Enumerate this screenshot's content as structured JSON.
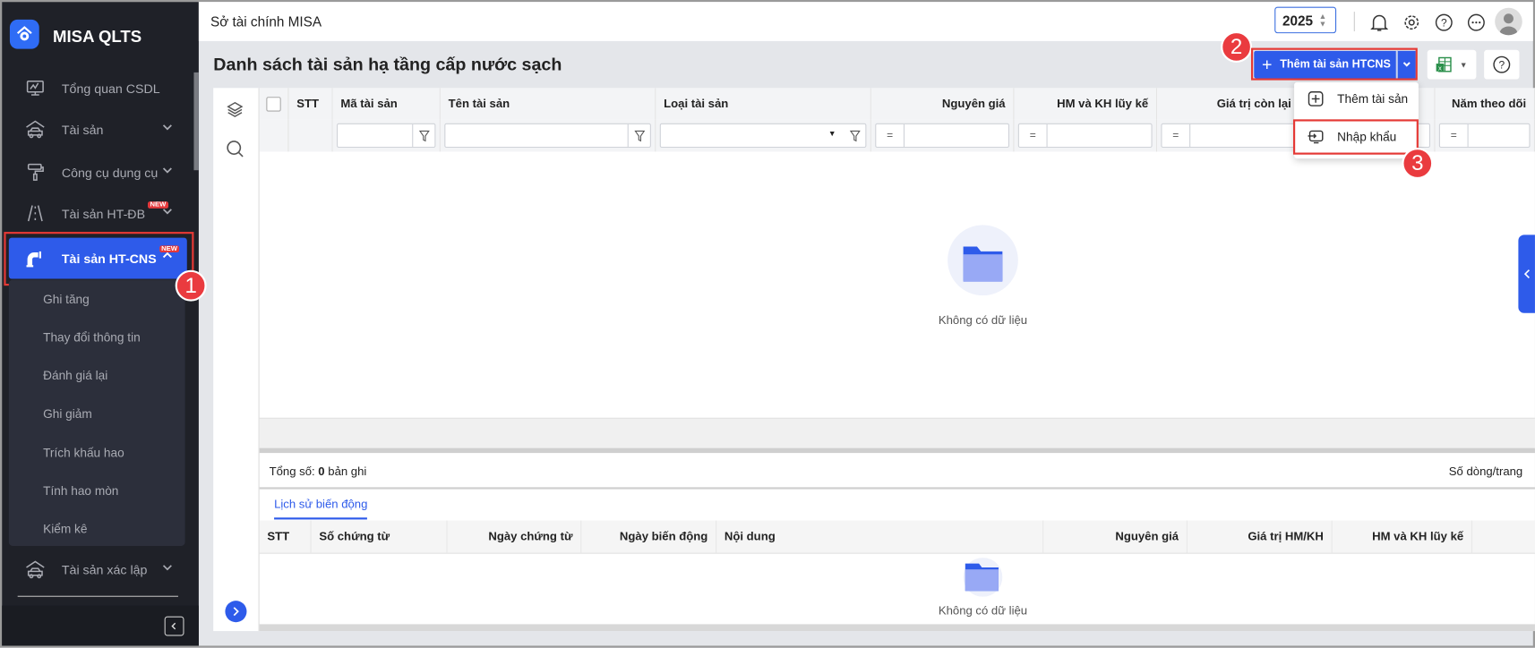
{
  "app": {
    "brand": "MISA QLTS",
    "org": "Sở tài chính MISA",
    "year": "2025"
  },
  "sidebar": {
    "items": [
      {
        "label": "Tổng quan CSDL",
        "icon": "monitor-chart-icon"
      },
      {
        "label": "Tài sản",
        "icon": "house-car-icon"
      },
      {
        "label": "Công cụ dụng cụ",
        "icon": "paint-roller-icon"
      },
      {
        "label": "Tài sản HT-ĐB",
        "icon": "road-icon",
        "badge": "NEW"
      },
      {
        "label": "Tài sản HT-CNS",
        "icon": "water-pipe-icon",
        "badge": "NEW"
      },
      {
        "label": "Tài sản xác lập",
        "icon": "house-car-icon"
      }
    ],
    "subitems": [
      "Ghi tăng",
      "Thay đổi thông tin",
      "Đánh giá lại",
      "Ghi giảm",
      "Trích khấu hao",
      "Tính hao mòn",
      "Kiểm kê"
    ]
  },
  "steps": [
    "1",
    "2",
    "3"
  ],
  "page": {
    "title": "Danh sách tài sản hạ tầng cấp nước sạch",
    "add_button": "Thêm tài sản HTCNS",
    "dropdown": [
      "Thêm tài sản",
      "Nhập khẩu"
    ]
  },
  "grid": {
    "columns": [
      "STT",
      "Mã tài sản",
      "Tên tài sản",
      "Loại tài sản",
      "Nguyên giá",
      "HM và KH lũy kế",
      "Giá trị còn lại",
      "Năm theo dõi"
    ],
    "eq": "=",
    "empty": "Không có dữ liệu",
    "total_label": "Tổng số:",
    "total_count": "0",
    "total_suffix": "bản ghi",
    "page_size_label": "Số dòng/trang"
  },
  "history": {
    "tab": "Lịch sử biến động",
    "columns": [
      "STT",
      "Số chứng từ",
      "Ngày chứng từ",
      "Ngày biến động",
      "Nội dung",
      "Nguyên giá",
      "Giá trị HM/KH",
      "HM và KH lũy kế"
    ],
    "empty": "Không có dữ liệu"
  }
}
